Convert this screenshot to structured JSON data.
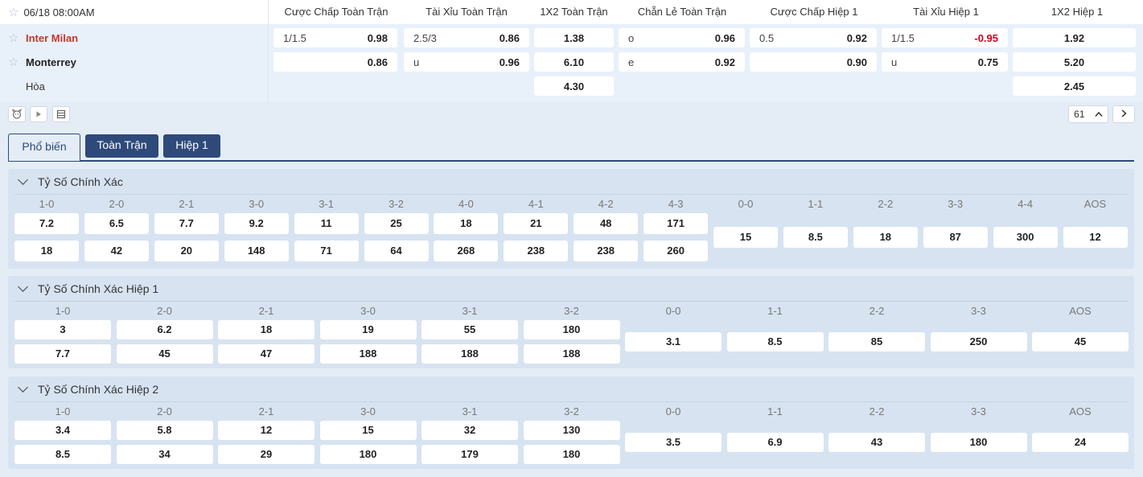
{
  "match": {
    "date": "06/18 08:00AM",
    "home": "Inter Milan",
    "away": "Monterrey",
    "draw": "Hòa"
  },
  "market_headers": [
    "Cược Chấp Toàn Trận",
    "Tài Xỉu Toàn Trận",
    "1X2 Toàn Trận",
    "Chẵn Lẻ Toàn Trận",
    "Cược Chấp Hiệp 1",
    "Tài Xỉu Hiệp 1",
    "1X2 Hiệp 1"
  ],
  "odds": {
    "hdp_ft": [
      {
        "label": "1/1.5",
        "value": "0.98"
      },
      {
        "label": "",
        "value": "0.86"
      }
    ],
    "ou_ft": [
      {
        "label": "2.5/3",
        "value": "0.86"
      },
      {
        "label": "u",
        "value": "0.96"
      }
    ],
    "x12_ft": [
      "1.38",
      "6.10",
      "4.30"
    ],
    "oe_ft": [
      {
        "label": "o",
        "value": "0.96"
      },
      {
        "label": "e",
        "value": "0.92"
      }
    ],
    "hdp_h1": [
      {
        "label": "0.5",
        "value": "0.92"
      },
      {
        "label": "",
        "value": "0.90"
      }
    ],
    "ou_h1": [
      {
        "label": "1/1.5",
        "value": "-0.95"
      },
      {
        "label": "u",
        "value": "0.75"
      }
    ],
    "x12_h1": [
      "1.92",
      "5.20",
      "2.45"
    ]
  },
  "toolbar": {
    "count": "61",
    "icons": [
      "mascot-icon",
      "play-icon",
      "list-icon",
      "chevron-up-icon",
      "chevron-right-icon"
    ]
  },
  "tabs": [
    "Phổ biến",
    "Toàn Trận",
    "Hiệp 1"
  ],
  "sections": [
    {
      "title": "Tỷ Số Chính Xác",
      "paired": [
        {
          "label": "1-0",
          "home": "7.2",
          "away": "18"
        },
        {
          "label": "2-0",
          "home": "6.5",
          "away": "42"
        },
        {
          "label": "2-1",
          "home": "7.7",
          "away": "20"
        },
        {
          "label": "3-0",
          "home": "9.2",
          "away": "148"
        },
        {
          "label": "3-1",
          "home": "11",
          "away": "71"
        },
        {
          "label": "3-2",
          "home": "25",
          "away": "64"
        },
        {
          "label": "4-0",
          "home": "18",
          "away": "268"
        },
        {
          "label": "4-1",
          "home": "21",
          "away": "238"
        },
        {
          "label": "4-2",
          "home": "48",
          "away": "238"
        },
        {
          "label": "4-3",
          "home": "171",
          "away": "260"
        }
      ],
      "single": [
        {
          "label": "0-0",
          "value": "15"
        },
        {
          "label": "1-1",
          "value": "8.5"
        },
        {
          "label": "2-2",
          "value": "18"
        },
        {
          "label": "3-3",
          "value": "87"
        },
        {
          "label": "4-4",
          "value": "300"
        },
        {
          "label": "AOS",
          "value": "12"
        }
      ]
    },
    {
      "title": "Tỷ Số Chính Xác Hiệp 1",
      "paired": [
        {
          "label": "1-0",
          "home": "3",
          "away": "7.7"
        },
        {
          "label": "2-0",
          "home": "6.2",
          "away": "45"
        },
        {
          "label": "2-1",
          "home": "18",
          "away": "47"
        },
        {
          "label": "3-0",
          "home": "19",
          "away": "188"
        },
        {
          "label": "3-1",
          "home": "55",
          "away": "188"
        },
        {
          "label": "3-2",
          "home": "180",
          "away": "188"
        }
      ],
      "single": [
        {
          "label": "0-0",
          "value": "3.1"
        },
        {
          "label": "1-1",
          "value": "8.5"
        },
        {
          "label": "2-2",
          "value": "85"
        },
        {
          "label": "3-3",
          "value": "250"
        },
        {
          "label": "AOS",
          "value": "45"
        }
      ]
    },
    {
      "title": "Tỷ Số Chính Xác Hiệp 2",
      "paired": [
        {
          "label": "1-0",
          "home": "3.4",
          "away": "8.5"
        },
        {
          "label": "2-0",
          "home": "5.8",
          "away": "34"
        },
        {
          "label": "2-1",
          "home": "12",
          "away": "29"
        },
        {
          "label": "3-0",
          "home": "15",
          "away": "180"
        },
        {
          "label": "3-1",
          "home": "32",
          "away": "179"
        },
        {
          "label": "3-2",
          "home": "130",
          "away": "180"
        }
      ],
      "single": [
        {
          "label": "0-0",
          "value": "3.5"
        },
        {
          "label": "1-1",
          "value": "6.9"
        },
        {
          "label": "2-2",
          "value": "43"
        },
        {
          "label": "3-3",
          "value": "180"
        },
        {
          "label": "AOS",
          "value": "24"
        }
      ]
    }
  ]
}
